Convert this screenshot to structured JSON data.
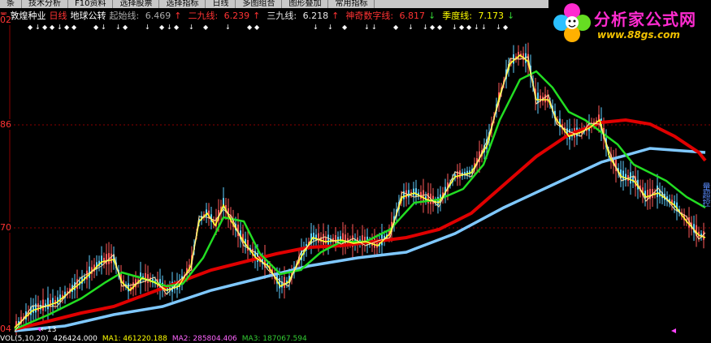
{
  "menubar": {
    "items": [
      "条",
      "技术分析",
      "F10资料",
      "选择股票",
      "选择指标",
      "日线",
      "多图组合",
      "图形叠加",
      "常用指标"
    ]
  },
  "info": {
    "stock_name": "敦煌种业",
    "period": "日线",
    "indicator": "地球公转",
    "lines": [
      {
        "label": "起始线:",
        "value": "6.469",
        "arrow": "↑",
        "color": "#aaaaaa"
      },
      {
        "label": "二九线:",
        "value": "6.239",
        "arrow": "↑",
        "color": "#ff3333"
      },
      {
        "label": "三九线:",
        "value": "6.218",
        "arrow": "↑",
        "color": "#e8e8e8"
      },
      {
        "label": "神奇数字线:",
        "value": "6.817",
        "arrow": "↓",
        "color": "#ff3333"
      },
      {
        "label": "季度线:",
        "value": "7.173",
        "arrow": "↓",
        "color": "#ffff00"
      }
    ]
  },
  "yaxis": {
    "labels": [
      "02",
      "86",
      "70",
      "04"
    ]
  },
  "chart_annotation": "13",
  "volume": {
    "label": "VOL(5,10,20)",
    "vol_value": "426424.000",
    "ma1": "MA1: 461220.188",
    "ma2": "MA2: 285804.406",
    "ma3": "MA3: 187067.594",
    "colors": {
      "vol": "#ffffff",
      "ma1": "#ffff00",
      "ma2": "#ff66ff",
      "ma3": "#33cc33"
    }
  },
  "logo": {
    "title": "分析家公式网",
    "url": "www.88gs.com"
  },
  "side_text": "量超控"
}
